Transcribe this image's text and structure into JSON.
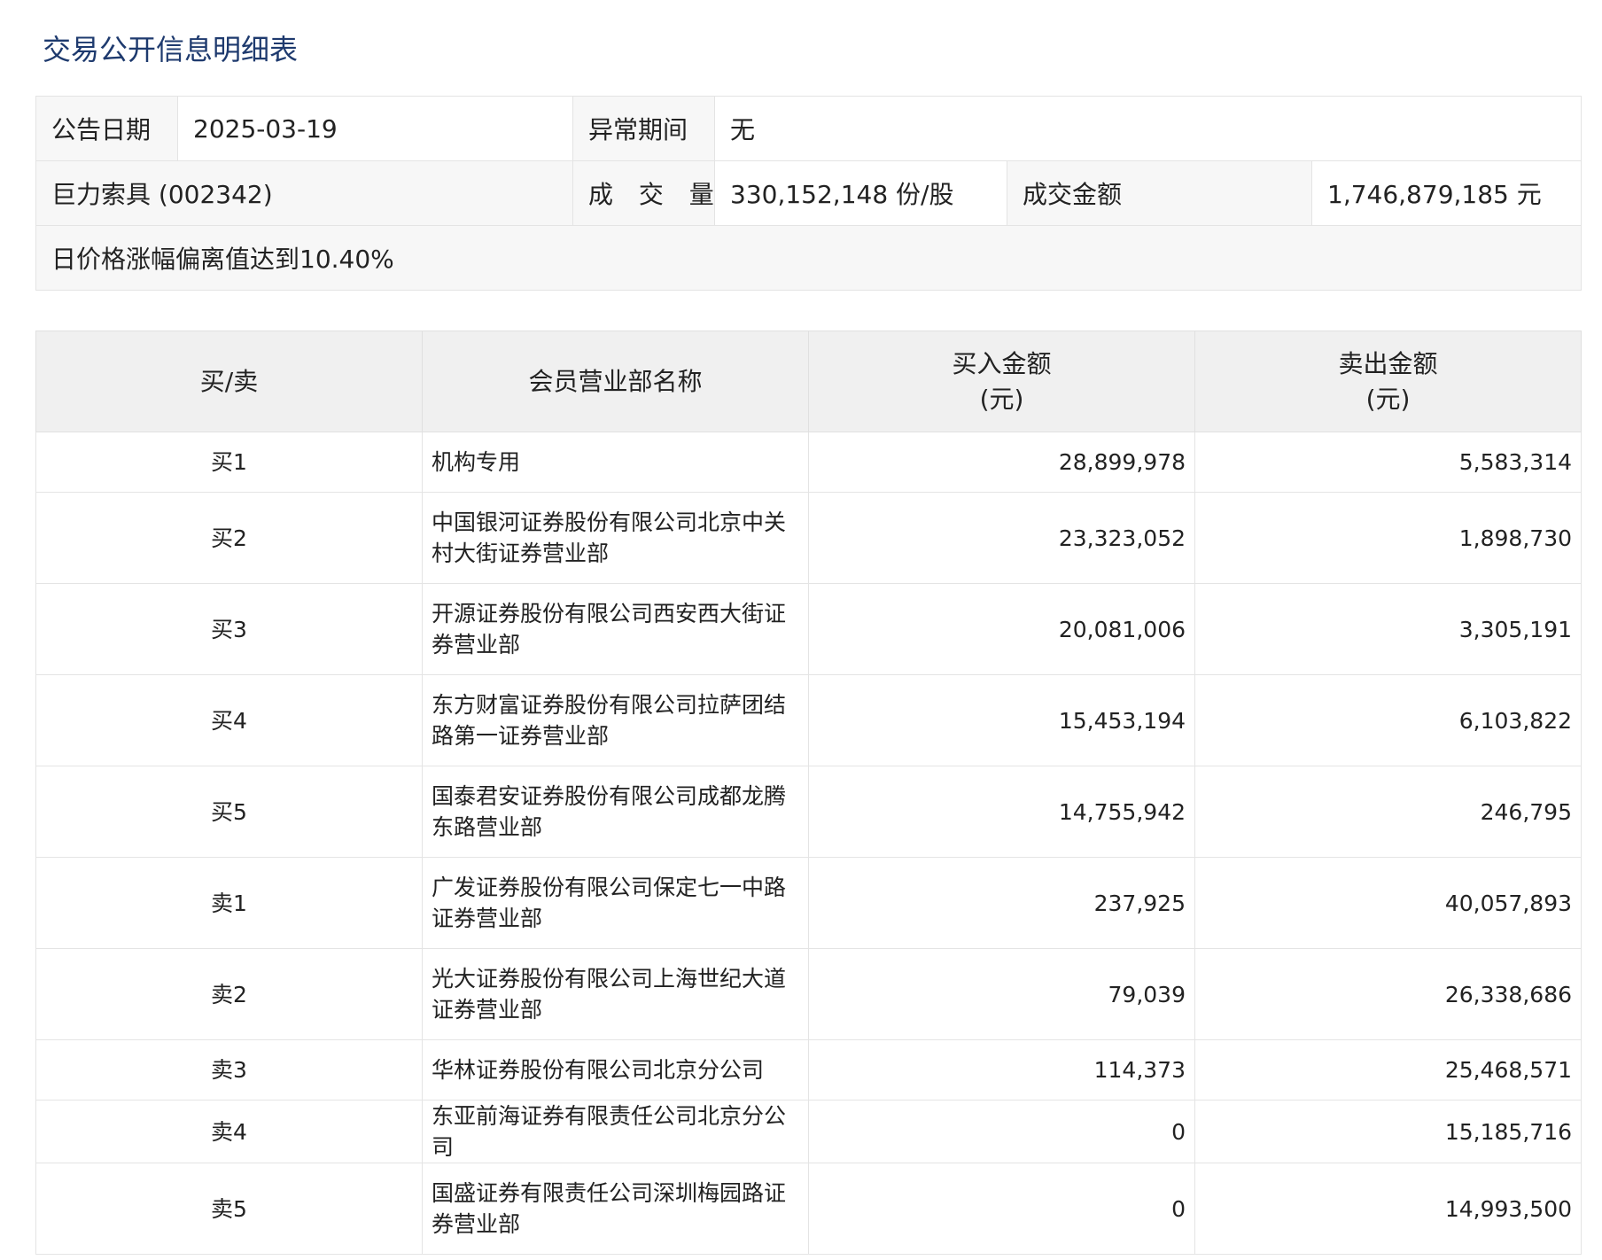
{
  "title": "交易公开信息明细表",
  "info": {
    "announce_date_label": "公告日期",
    "announce_date_value": "2025-03-19",
    "abnormal_period_label": "异常期间",
    "abnormal_period_value": "无",
    "stock_label": "巨力索具 (002342)",
    "volume_label": "成 交 量",
    "volume_value": "330,152,148 份/股",
    "amount_label": "成交金额",
    "amount_value": "1,746,879,185 元",
    "reason": "日价格涨幅偏离值达到10.40%"
  },
  "table": {
    "headers": {
      "side": "买/卖",
      "name": "会员营业部名称",
      "buy_line1": "买入金额",
      "buy_line2": "(元)",
      "sell_line1": "卖出金额",
      "sell_line2": "(元)"
    },
    "rows": [
      {
        "side": "买1",
        "name": "机构专用",
        "buy": "28,899,978",
        "sell": "5,583,314"
      },
      {
        "side": "买2",
        "name": "中国银河证券股份有限公司北京中关村大街证券营业部",
        "buy": "23,323,052",
        "sell": "1,898,730"
      },
      {
        "side": "买3",
        "name": "开源证券股份有限公司西安西大街证券营业部",
        "buy": "20,081,006",
        "sell": "3,305,191"
      },
      {
        "side": "买4",
        "name": "东方财富证券股份有限公司拉萨团结路第一证券营业部",
        "buy": "15,453,194",
        "sell": "6,103,822"
      },
      {
        "side": "买5",
        "name": "国泰君安证券股份有限公司成都龙腾东路营业部",
        "buy": "14,755,942",
        "sell": "246,795"
      },
      {
        "side": "卖1",
        "name": "广发证券股份有限公司保定七一中路证券营业部",
        "buy": "237,925",
        "sell": "40,057,893"
      },
      {
        "side": "卖2",
        "name": "光大证券股份有限公司上海世纪大道证券营业部",
        "buy": "79,039",
        "sell": "26,338,686"
      },
      {
        "side": "卖3",
        "name": "华林证券股份有限公司北京分公司",
        "buy": "114,373",
        "sell": "25,468,571"
      },
      {
        "side": "卖4",
        "name": "东亚前海证券有限责任公司北京分公司",
        "buy": "0",
        "sell": "15,185,716"
      },
      {
        "side": "卖5",
        "name": "国盛证券有限责任公司深圳梅园路证券营业部",
        "buy": "0",
        "sell": "14,993,500"
      }
    ]
  },
  "colors": {
    "title": "#1e3a6e",
    "header_bg": "#f0f0f0",
    "label_bg": "#f7f7f7",
    "border": "#e4e4e4"
  }
}
